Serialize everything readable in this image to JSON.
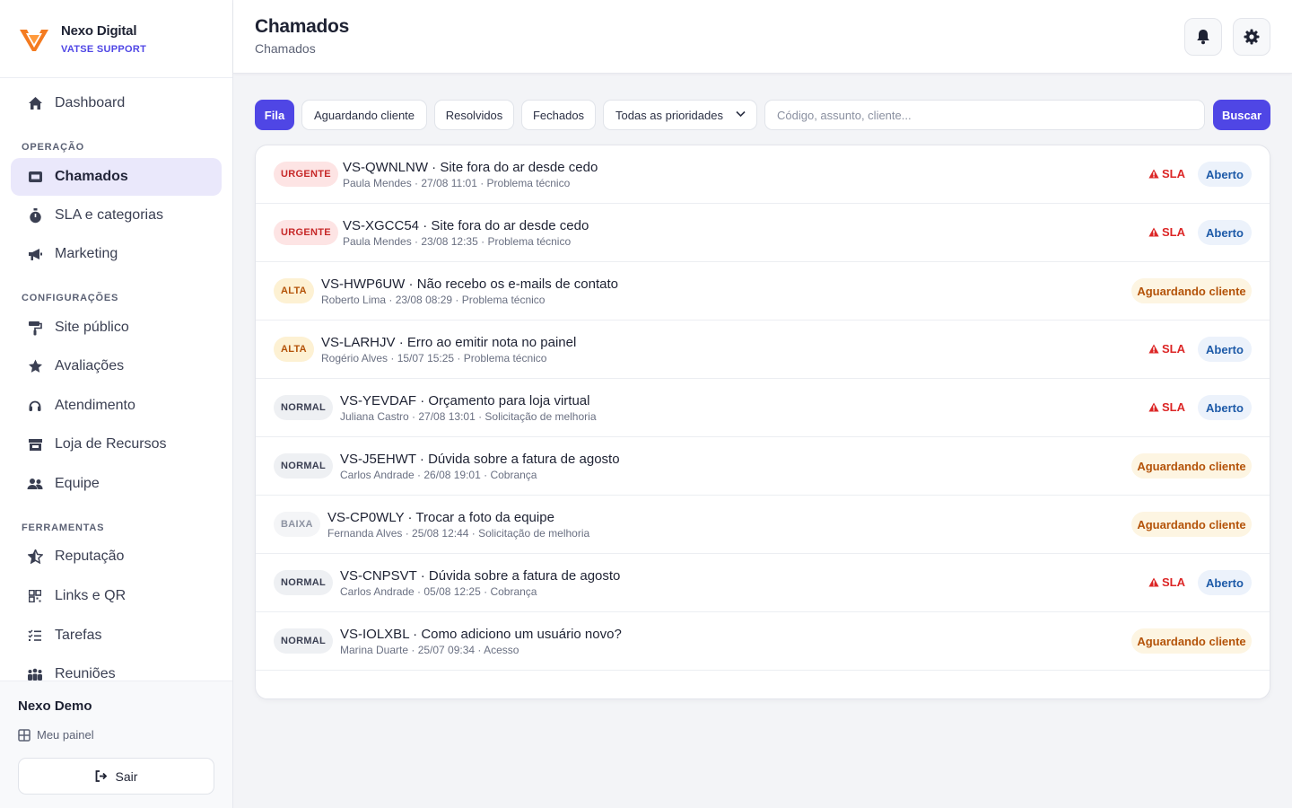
{
  "brand": {
    "name": "Nexo Digital",
    "sub": "VATSE SUPPORT"
  },
  "nav": {
    "dashboard": "Dashboard",
    "section_operacao": "OPERAÇÃO",
    "chamados": "Chamados",
    "sla": "SLA e categorias",
    "marketing": "Marketing",
    "section_config": "CONFIGURAÇÕES",
    "site": "Site público",
    "avaliacoes": "Avaliações",
    "atendimento": "Atendimento",
    "loja": "Loja de Recursos",
    "equipe": "Equipe",
    "section_ferramentas": "FERRAMENTAS",
    "reputacao": "Reputação",
    "links": "Links e QR",
    "tarefas": "Tarefas",
    "reunioes": "Reuniões"
  },
  "user": {
    "name": "Nexo Demo",
    "panel": "Meu painel",
    "logout": "Sair"
  },
  "header": {
    "title": "Chamados",
    "subtitle": "Chamados"
  },
  "filters": {
    "fila": "Fila",
    "aguardando": "Aguardando cliente",
    "resolvidos": "Resolvidos",
    "fechados": "Fechados",
    "prioridade": "Todas as prioridades",
    "search_placeholder": "Código, assunto, cliente...",
    "buscar": "Buscar"
  },
  "tickets": [
    {
      "priority": "URGENTE",
      "code": "VS-QWNLNW",
      "subject": "Site fora do ar desde cedo",
      "meta": "Paula Mendes · 27/08 11:01 · Problema técnico",
      "sla": "SLA",
      "status": "Aberto"
    },
    {
      "priority": "URGENTE",
      "code": "VS-XGCC54",
      "subject": "Site fora do ar desde cedo",
      "meta": "Paula Mendes · 23/08 12:35 · Problema técnico",
      "sla": "SLA",
      "status": "Aberto"
    },
    {
      "priority": "ALTA",
      "code": "VS-HWP6UW",
      "subject": "Não recebo os e-mails de contato",
      "meta": "Roberto Lima · 23/08 08:29 · Problema técnico",
      "sla": "",
      "status": "Aguardando cliente"
    },
    {
      "priority": "ALTA",
      "code": "VS-LARHJV",
      "subject": "Erro ao emitir nota no painel",
      "meta": "Rogério Alves · 15/07 15:25 · Problema técnico",
      "sla": "SLA",
      "status": "Aberto"
    },
    {
      "priority": "NORMAL",
      "code": "VS-YEVDAF",
      "subject": "Orçamento para loja virtual",
      "meta": "Juliana Castro · 27/08 13:01 · Solicitação de melhoria",
      "sla": "SLA",
      "status": "Aberto"
    },
    {
      "priority": "NORMAL",
      "code": "VS-J5EHWT",
      "subject": "Dúvida sobre a fatura de agosto",
      "meta": "Carlos Andrade · 26/08 19:01 · Cobrança",
      "sla": "",
      "status": "Aguardando cliente"
    },
    {
      "priority": "BAIXA",
      "code": "VS-CP0WLY",
      "subject": "Trocar a foto da equipe",
      "meta": "Fernanda Alves · 25/08 12:44 · Solicitação de melhoria",
      "sla": "",
      "status": "Aguardando cliente"
    },
    {
      "priority": "NORMAL",
      "code": "VS-CNPSVT",
      "subject": "Dúvida sobre a fatura de agosto",
      "meta": "Carlos Andrade · 05/08 12:25 · Cobrança",
      "sla": "SLA",
      "status": "Aberto"
    },
    {
      "priority": "NORMAL",
      "code": "VS-IOLXBL",
      "subject": "Como adiciono um usuário novo?",
      "meta": "Marina Duarte · 25/07 09:34 · Acesso",
      "sla": "",
      "status": "Aguardando cliente"
    }
  ],
  "colors": {
    "accent": "#4f46e5",
    "urgent": "#c62828",
    "high": "#b45309",
    "sla": "#dc2626",
    "open": "#1d5aa8"
  }
}
